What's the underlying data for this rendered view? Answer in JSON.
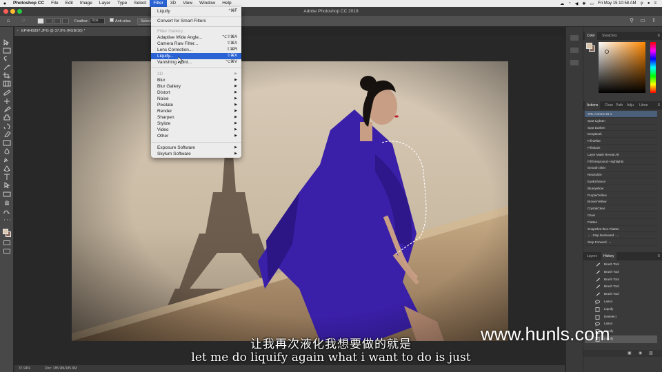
{
  "menubar": {
    "app_name": "Photoshop CC",
    "items": [
      "File",
      "Edit",
      "Image",
      "Layer",
      "Type",
      "Select",
      "Filter",
      "3D",
      "View",
      "Window",
      "Help"
    ],
    "active": "Filter",
    "clock": "Fri May 15  10:58 AM"
  },
  "titlebar": {
    "title": "Adobe Photoshop CC 2019"
  },
  "options": {
    "feather_label": "Feather:",
    "feather_value": "0 px",
    "antialias_label": "Anti-alias",
    "select_label": "Select"
  },
  "document": {
    "tab": "EPHH5897.JPG @ 37.9% (RGB/16) *",
    "zoom": "37.94%",
    "doc_info": "Doc: 185.9M/185.9M"
  },
  "filter_menu": {
    "top": [
      {
        "label": "Liquify",
        "shortcut": "^⌘F",
        "disabled": false
      },
      {
        "label": "Convert for Smart Filters",
        "disabled": false
      }
    ],
    "mid": [
      {
        "label": "Filter Gallery...",
        "disabled": true
      },
      {
        "label": "Adaptive Wide Angle...",
        "shortcut": "⌥⇧⌘A",
        "disabled": false
      },
      {
        "label": "Camera Raw Filter...",
        "shortcut": "⇧⌘A",
        "disabled": false
      },
      {
        "label": "Lens Correction...",
        "shortcut": "⇧⌘R",
        "disabled": false
      },
      {
        "label": "Liquify...",
        "shortcut": "⇧⌘X",
        "disabled": false,
        "highlighted": true
      },
      {
        "label": "Vanishing Point...",
        "shortcut": "⌥⌘V",
        "disabled": false
      }
    ],
    "sub": [
      {
        "label": "3D",
        "disabled": true
      },
      {
        "label": "Blur"
      },
      {
        "label": "Blur Gallery"
      },
      {
        "label": "Distort"
      },
      {
        "label": "Noise"
      },
      {
        "label": "Pixelate"
      },
      {
        "label": "Render"
      },
      {
        "label": "Sharpen"
      },
      {
        "label": "Stylize"
      },
      {
        "label": "Video"
      },
      {
        "label": "Other"
      }
    ],
    "plugins": [
      {
        "label": "Exposure Software"
      },
      {
        "label": "Skylum Software"
      }
    ]
  },
  "color_panel": {
    "tabs": [
      "Color",
      "Swatches"
    ],
    "fg": "#d8c4aa",
    "bg": "#8a6a58"
  },
  "actions_panel": {
    "tabs": [
      "Actions",
      "Chan",
      "Path",
      "Adju",
      "Librar"
    ],
    "items": [
      "SRL Actions 20.4",
      "Spot Lighten",
      "Spot Darken",
      "DeepDark",
      "Fill White",
      "Fill Black",
      "Layer Mask Reveal All",
      "Fill foreground- Highlights",
      "Smooth Skin",
      "Neutralize",
      "EyeEnhance",
      "Blue/yellow",
      "Purple/Yellow",
      "Brown/Yellow",
      "CrystalClear",
      "Grain",
      "Flatten",
      "SnapShot then Flatten",
      "←· Step Backward ·→",
      "Step Forward ·→"
    ]
  },
  "history_panel": {
    "tabs": [
      "Layers",
      "History"
    ],
    "items": [
      {
        "label": "Brush Tool",
        "icon": "brush-icon"
      },
      {
        "label": "Brush Tool",
        "icon": "brush-icon"
      },
      {
        "label": "Brush Tool",
        "icon": "brush-icon"
      },
      {
        "label": "Brush Tool",
        "icon": "brush-icon"
      },
      {
        "label": "Brush Tool",
        "icon": "brush-icon"
      },
      {
        "label": "Lasso",
        "icon": "lasso-icon"
      },
      {
        "label": "Liquify",
        "icon": "document-icon"
      },
      {
        "label": "Deselect",
        "icon": "document-icon"
      },
      {
        "label": "Lasso",
        "icon": "lasso-icon"
      },
      {
        "label": "Liquify",
        "icon": "document-icon"
      },
      {
        "label": "Liquify",
        "icon": "document-icon"
      }
    ]
  },
  "subtitle": {
    "cn": "让我再次液化我想要做的就是",
    "en": "let me do liquify again what i want to do is just"
  },
  "watermark": "www.hunls.com",
  "colors": {
    "menu_highlight": "#2a63d4",
    "dress": "#3a1fa8",
    "panel": "#3a3a3a",
    "window_red": "#ff5f57",
    "window_yellow": "#febc2e",
    "window_green": "#28c840"
  }
}
